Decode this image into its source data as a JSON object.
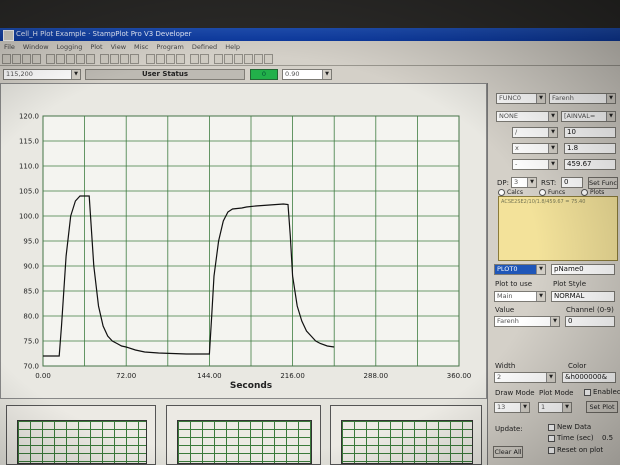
{
  "window": {
    "title": "Cell_H Plot Example · StampPlot Pro V3 Developer"
  },
  "menu": [
    "File",
    "Window",
    "Logging",
    "Plot",
    "View",
    "Misc",
    "Program",
    "Defined",
    "Help"
  ],
  "status_row": {
    "left_combo": "115,200",
    "user_status": "User Status",
    "indicator": "0",
    "right_combo": "0.90"
  },
  "chart_data": {
    "type": "line",
    "xlabel": "Seconds",
    "xlim": [
      0,
      360
    ],
    "ylim": [
      70,
      120
    ],
    "xticks": [
      "0.00",
      "72.00",
      "144.00",
      "216.00",
      "288.00",
      "360.00"
    ],
    "yticks": [
      "120.0",
      "115.0",
      "110.0",
      "105.0",
      "100.0",
      "95.0",
      "90.0",
      "85.0",
      "80.0",
      "75.0",
      "70.0"
    ],
    "grid": true,
    "series": [
      {
        "x": [
          0,
          14,
          16,
          20,
          24,
          28,
          32,
          36,
          40,
          44,
          48,
          52,
          56,
          60,
          64,
          68,
          72,
          80,
          88,
          100,
          112,
          124,
          136,
          144,
          146,
          148,
          152,
          156,
          160,
          164,
          168,
          172,
          176,
          184,
          196,
          208,
          212,
          214,
          216,
          220,
          224,
          228,
          232,
          236,
          240,
          246,
          252
        ],
        "y": [
          72,
          72,
          78,
          92,
          100,
          103,
          104,
          104,
          104,
          90,
          82,
          78,
          76,
          75,
          74.5,
          74,
          73.8,
          73.2,
          72.8,
          72.6,
          72.5,
          72.4,
          72.4,
          72.4,
          80,
          88,
          95,
          99,
          100.8,
          101.4,
          101.5,
          101.6,
          101.8,
          102,
          102.2,
          102.4,
          102.3,
          96,
          88,
          82,
          79,
          77,
          76,
          75,
          74.5,
          74,
          73.8
        ]
      }
    ]
  },
  "panel": {
    "row1": {
      "left": "FUNC0",
      "right": "Farenh"
    },
    "row2": {
      "left": "NONE",
      "right": "[AINVAL="
    },
    "row3": {
      "left": "/",
      "right": "10"
    },
    "row4": {
      "left": "x",
      "right": "1.8"
    },
    "row5": {
      "left": "-",
      "right": "459.67"
    },
    "dp_label": "DP:",
    "dp_value": "3",
    "rst_label": "RST:",
    "rst_value": "0",
    "set_func": "Set Func",
    "radios": [
      "Calcs",
      "Funcs",
      "Plots"
    ],
    "func_text": "ACSE2SE2/10/1.8/459.67 = 75.40",
    "plot_combo": "PLOT0",
    "plot_name": "pName0",
    "plot_to_use_label": "Plot to use",
    "plot_style_label": "Plot Style",
    "plot_to_use": "Main",
    "plot_style": "NORMAL",
    "value_label": "Value",
    "channel_label": "Channel (0-9)",
    "value": "Farenh",
    "channel": "0",
    "width_label": "Width",
    "color_label": "Color",
    "width": "2",
    "color": "&h000000&",
    "draw_mode_label": "Draw Mode",
    "plot_mode_label": "Plot Mode",
    "enabled_label": "Enabled",
    "draw_mode": "13",
    "plot_mode": "1",
    "set_plot": "Set Plot",
    "update_label": "Update:",
    "new_data": "New Data",
    "time_label": "Time (sec)",
    "time_value": "0.5",
    "reset_on_plot": "Reset on plot",
    "clear_all": "Clear All"
  }
}
